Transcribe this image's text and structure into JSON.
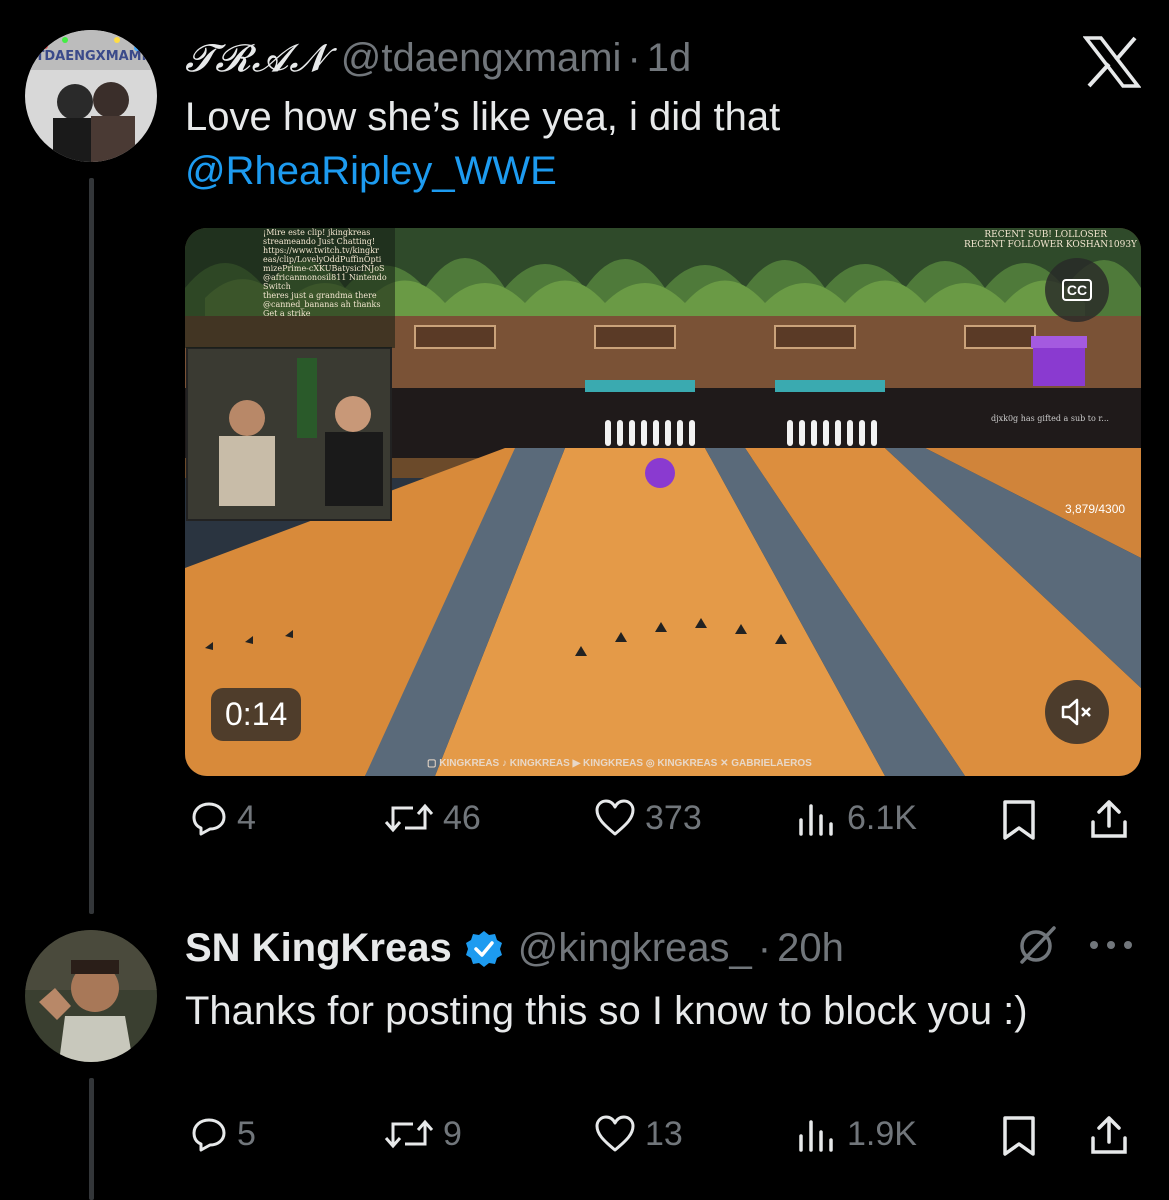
{
  "tweet1": {
    "display_name": "𝓣𝓡𝓐𝓝",
    "handle": "@tdaengxmami",
    "separator": "·",
    "time": "1d",
    "text": "Love how she’s like yea, i did that",
    "mention": "@RheaRipley_WWE",
    "avatar_label": "TDAENGXMAMI",
    "video": {
      "timestamp": "0:14",
      "cc_label": "CC",
      "overlay_top_right_1": "RECENT SUB! LOLLOSER",
      "overlay_top_right_2": "RECENT FOLLOWER KOSHAN1093Y",
      "gift_text": "djxk0g has gifted a sub to r...",
      "counter": "3,879/4300",
      "bottom_banner": "▢ KINGKREAS ♪ KINGKREAS ▶ KINGKREAS ◎ KINGKREAS ✕ GABRIELAEROS",
      "chat_lines": [
        "¡Mire este clip! jkingkreas",
        "streameando Just Chatting!",
        "https://www.twitch.tv/kingkr",
        "eas/clip/LovelyOddPuffinOpti",
        "mizePrime-cXKUBatysicfNJoS",
        "@africanmonosil811 Nintendo",
        "Switch",
        "theres just a grandma there",
        "@canned_bananas ah thanks",
        "Get a strike"
      ]
    },
    "stats": {
      "replies": "4",
      "reposts": "46",
      "likes": "373",
      "views": "6.1K"
    }
  },
  "tweet2": {
    "display_name": "SN KingKreas",
    "handle": "@kingkreas_",
    "separator": "·",
    "time": "20h",
    "text": "Thanks for posting this so I know to block you :)",
    "stats": {
      "replies": "5",
      "reposts": "9",
      "likes": "13",
      "views": "1.9K"
    }
  },
  "icons": {
    "x_logo": "x-logo-icon",
    "verified": "verified-badge-icon",
    "grok": "grok-icon",
    "more": "more-icon",
    "reply": "reply-icon",
    "repost": "repost-icon",
    "like": "like-icon",
    "views": "views-icon",
    "bookmark": "bookmark-icon",
    "share": "share-icon"
  },
  "colors": {
    "background": "#000000",
    "text": "#e7e9ea",
    "muted": "#71767b",
    "link": "#1d9bf0",
    "verified": "#1d9bf0"
  }
}
